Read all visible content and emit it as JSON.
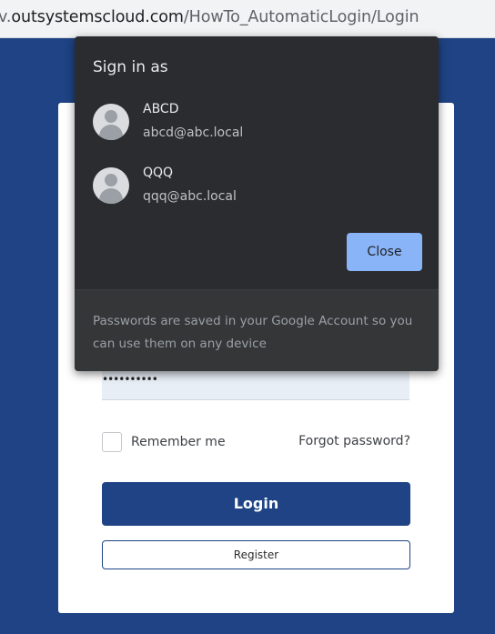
{
  "browser": {
    "url_prefix": "v.",
    "url_host": "outsystemscloud.com",
    "url_path": "/HowTo_AutomaticLogin/Login"
  },
  "login_form": {
    "password_mask": "••••••••••",
    "remember_label": "Remember me",
    "forgot_label": "Forgot password?",
    "login_label": "Login",
    "register_label": "Register"
  },
  "popup": {
    "title": "Sign in as",
    "accounts": [
      {
        "name": "ABCD",
        "email": "abcd@abc.local",
        "icon": "avatar-icon"
      },
      {
        "name": "QQQ",
        "email": "qqq@abc.local",
        "icon": "avatar-icon"
      }
    ],
    "close_label": "Close",
    "footer_text": "Passwords are saved in your Google Account so you can use them on any device"
  },
  "colors": {
    "page_background": "#1f4384",
    "login_button": "#1f4384",
    "popup_background": "#2b2c2f",
    "close_button": "#8ab4f8"
  }
}
